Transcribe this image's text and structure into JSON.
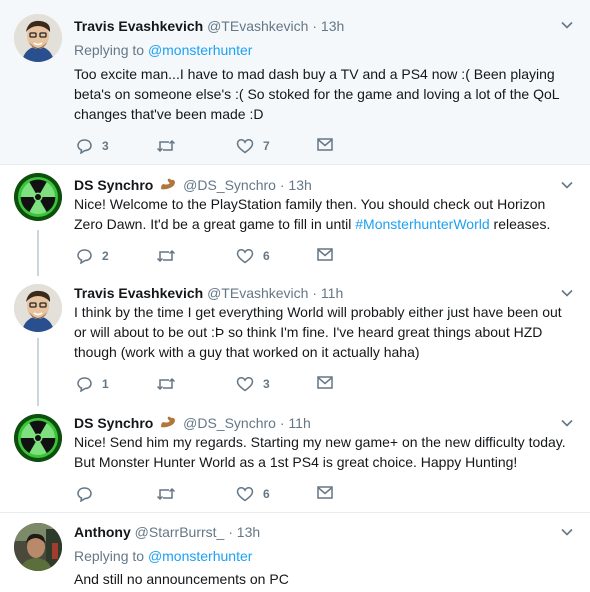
{
  "tweets": [
    {
      "name": "Travis Evashkevich",
      "handle": "@TEvashkevich",
      "time": "13h",
      "reply_prefix": "Replying to ",
      "reply_to": "@monsterhunter",
      "text": "Too excite man...I have to mad dash buy a TV and a PS4 now :( Been playing beta's on someone else's :( So stoked for the game and loving a lot of the QoL changes that've been made :D",
      "replies": "3",
      "retweets": "",
      "likes": "7"
    },
    {
      "name": "DS Synchro",
      "handle": "@DS_Synchro",
      "time": "13h",
      "text_before": "Nice! Welcome to the PlayStation family then. You should check out Horizon Zero Dawn. It'd be a great game to fill in until ",
      "hashtag": "#MonsterhunterWorld",
      "text_after": " releases.",
      "replies": "2",
      "retweets": "",
      "likes": "6"
    },
    {
      "name": "Travis Evashkevich",
      "handle": "@TEvashkevich",
      "time": "11h",
      "text": "I think by the time I get everything World will probably either just have been out or will about to be out :Þ so think I'm fine. I've heard great things about HZD though (work with a guy that worked on it actually haha)",
      "replies": "1",
      "retweets": "",
      "likes": "3"
    },
    {
      "name": "DS Synchro",
      "handle": "@DS_Synchro",
      "time": "11h",
      "text": "Nice! Send him my regards. Starting my new game+ on the new difficulty today. But Monster Hunter World as a 1st PS4 is great choice. Happy Hunting!",
      "replies": "",
      "retweets": "",
      "likes": "6"
    },
    {
      "name": "Anthony",
      "handle": "@StarrBurrst_",
      "time": "13h",
      "reply_prefix": "Replying to ",
      "reply_to": "@monsterhunter",
      "text": "And still no announcements on PC"
    }
  ],
  "dot": "·",
  "colors": {
    "link": "#1da1f2",
    "muted": "#657786",
    "highlight_bg": "#f5f8fa",
    "thread": "#ccd6dd"
  },
  "icons": [
    "reply-icon",
    "retweet-icon",
    "like-icon",
    "dm-icon",
    "chevron-down-icon",
    "flexed-biceps-emoji"
  ]
}
